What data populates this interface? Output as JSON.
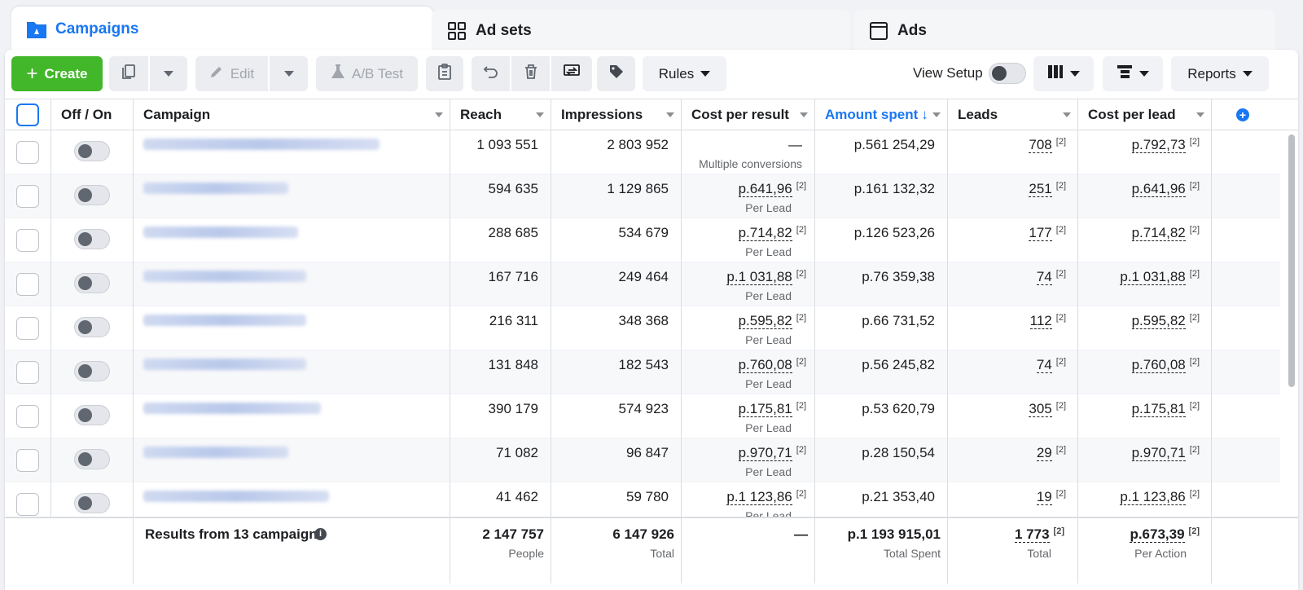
{
  "tabs": [
    {
      "label": "Campaigns",
      "icon": "folder-icon",
      "active": true
    },
    {
      "label": "Ad sets",
      "icon": "grid-icon",
      "active": false
    },
    {
      "label": "Ads",
      "icon": "ad-window-icon",
      "active": false
    }
  ],
  "toolbar": {
    "create_label": "Create",
    "edit_label": "Edit",
    "ab_test_label": "A/B Test",
    "rules_label": "Rules",
    "view_setup_label": "View Setup",
    "reports_label": "Reports"
  },
  "columns": [
    "Off / On",
    "Campaign",
    "Reach",
    "Impressions",
    "Cost per result",
    "Amount spent",
    "Leads",
    "Cost per lead"
  ],
  "sort_arrow": "↓",
  "footnote": "[2]",
  "rows": [
    {
      "reach": "1 093 551",
      "impressions": "2 803 952",
      "cpr": "—",
      "cpr_sub": "Multiple conversions",
      "spent": "p.561 254,29",
      "leads": "708",
      "cpl": "p.792,73"
    },
    {
      "reach": "594 635",
      "impressions": "1 129 865",
      "cpr": "p.641,96",
      "cpr_sub": "Per Lead",
      "spent": "p.161 132,32",
      "leads": "251",
      "cpl": "p.641,96"
    },
    {
      "reach": "288 685",
      "impressions": "534 679",
      "cpr": "p.714,82",
      "cpr_sub": "Per Lead",
      "spent": "p.126 523,26",
      "leads": "177",
      "cpl": "p.714,82"
    },
    {
      "reach": "167 716",
      "impressions": "249 464",
      "cpr": "p.1 031,88",
      "cpr_sub": "Per Lead",
      "spent": "p.76 359,38",
      "leads": "74",
      "cpl": "p.1 031,88"
    },
    {
      "reach": "216 311",
      "impressions": "348 368",
      "cpr": "p.595,82",
      "cpr_sub": "Per Lead",
      "spent": "p.66 731,52",
      "leads": "112",
      "cpl": "p.595,82"
    },
    {
      "reach": "131 848",
      "impressions": "182 543",
      "cpr": "p.760,08",
      "cpr_sub": "Per Lead",
      "spent": "p.56 245,82",
      "leads": "74",
      "cpl": "p.760,08"
    },
    {
      "reach": "390 179",
      "impressions": "574 923",
      "cpr": "p.175,81",
      "cpr_sub": "Per Lead",
      "spent": "p.53 620,79",
      "leads": "305",
      "cpl": "p.175,81"
    },
    {
      "reach": "71 082",
      "impressions": "96 847",
      "cpr": "p.970,71",
      "cpr_sub": "Per Lead",
      "spent": "p.28 150,54",
      "leads": "29",
      "cpl": "p.970,71"
    },
    {
      "reach": "41 462",
      "impressions": "59 780",
      "cpr": "p.1 123,86",
      "cpr_sub": "Per Lead",
      "spent": "p.21 353,40",
      "leads": "19",
      "cpl": "p.1 123,86"
    }
  ],
  "totals": {
    "label": "Results from 13 campaigns",
    "reach": "2 147 757",
    "reach_sub": "People",
    "impressions": "6 147 926",
    "impressions_sub": "Total",
    "cpr": "—",
    "spent": "p.1 193 915,01",
    "spent_sub": "Total Spent",
    "leads": "1 773",
    "leads_sub": "Total",
    "cpl": "p.673,39",
    "cpl_sub": "Per Action"
  },
  "colors": {
    "accent": "#1877f2",
    "create": "#42b72a"
  }
}
